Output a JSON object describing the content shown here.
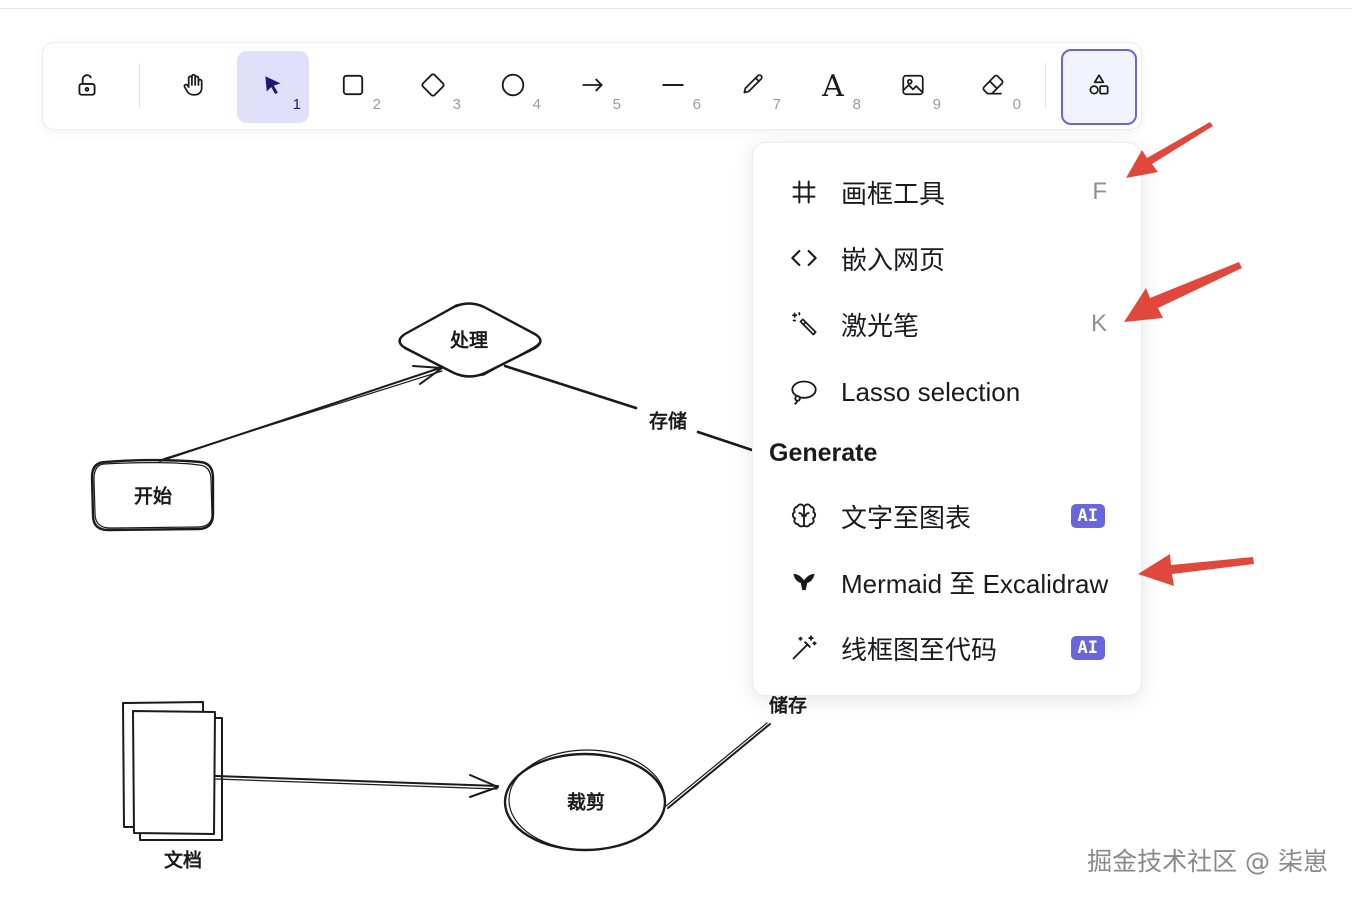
{
  "toolbar": {
    "tools": [
      {
        "name": "lock",
        "key": ""
      },
      {
        "name": "hand",
        "key": ""
      },
      {
        "name": "selection",
        "key": "1"
      },
      {
        "name": "rectangle",
        "key": "2"
      },
      {
        "name": "diamond",
        "key": "3"
      },
      {
        "name": "ellipse",
        "key": "4"
      },
      {
        "name": "arrow",
        "key": "5"
      },
      {
        "name": "line",
        "key": "6"
      },
      {
        "name": "pencil",
        "key": "7"
      },
      {
        "name": "text",
        "key": "8",
        "glyph": "A"
      },
      {
        "name": "image",
        "key": "9"
      },
      {
        "name": "eraser",
        "key": "0"
      },
      {
        "name": "more-tools",
        "key": ""
      }
    ],
    "active_tool": "selection",
    "accent_color": "#6965db",
    "active_bg": "#e1e0fb"
  },
  "menu": {
    "items": [
      {
        "label": "画框工具",
        "shortcut": "F",
        "icon": "frame-icon"
      },
      {
        "label": "嵌入网页",
        "shortcut": "",
        "icon": "code-icon"
      },
      {
        "label": "激光笔",
        "shortcut": "K",
        "icon": "laser-pointer-icon"
      },
      {
        "label": "Lasso selection",
        "shortcut": "",
        "icon": "lasso-icon"
      }
    ],
    "generate_heading": "Generate",
    "generate_items": [
      {
        "label": "文字至图表",
        "badge": "AI",
        "icon": "brain-icon"
      },
      {
        "label": "Mermaid 至 Excalidraw",
        "badge": "",
        "icon": "mermaid-icon"
      },
      {
        "label": "线框图至代码",
        "badge": "AI",
        "icon": "magic-wand-icon"
      }
    ]
  },
  "canvas": {
    "labels": {
      "start": "开始",
      "process": "处理",
      "store": "存储",
      "doc": "文档",
      "crop": "裁剪",
      "storage": "储存"
    }
  },
  "annotation_color": "#e0483c",
  "watermark": "掘金技术社区 @ 柒崽"
}
